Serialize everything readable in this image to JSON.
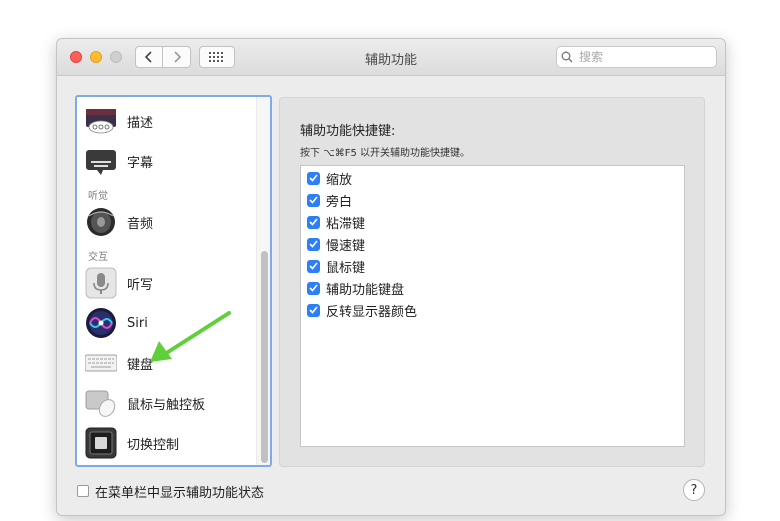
{
  "window": {
    "title": "辅助功能",
    "search_placeholder": "搜索"
  },
  "sidebar": {
    "items": [
      {
        "label": "描述",
        "icon": "descriptions-icon"
      },
      {
        "label": "字幕",
        "icon": "captions-icon"
      },
      {
        "label": "音频",
        "icon": "speaker-icon"
      },
      {
        "label": "听写",
        "icon": "microphone-icon"
      },
      {
        "label": "Siri",
        "icon": "siri-icon"
      },
      {
        "label": "键盘",
        "icon": "keyboard-icon"
      },
      {
        "label": "鼠标与触控板",
        "icon": "mouse-trackpad-icon"
      },
      {
        "label": "切换控制",
        "icon": "switch-control-icon"
      }
    ],
    "section_hearing": "听觉",
    "section_interaction": "交互"
  },
  "main": {
    "heading": "辅助功能快捷键:",
    "hint": "按下 ⌥⌘F5 以开关辅助功能快捷键。",
    "shortcuts": [
      {
        "label": "缩放",
        "checked": true
      },
      {
        "label": "旁白",
        "checked": true
      },
      {
        "label": "粘滞键",
        "checked": true
      },
      {
        "label": "慢速键",
        "checked": true
      },
      {
        "label": "鼠标键",
        "checked": true
      },
      {
        "label": "辅助功能键盘",
        "checked": true
      },
      {
        "label": "反转显示器颜色",
        "checked": true
      }
    ]
  },
  "footer": {
    "show_status_label": "在菜单栏中显示辅助功能状态",
    "show_status_checked": false,
    "help_label": "?"
  },
  "colors": {
    "accent": "#2d7ff9",
    "annotation_arrow": "#5fcf3a",
    "focus_ring": "#7eabe8"
  }
}
